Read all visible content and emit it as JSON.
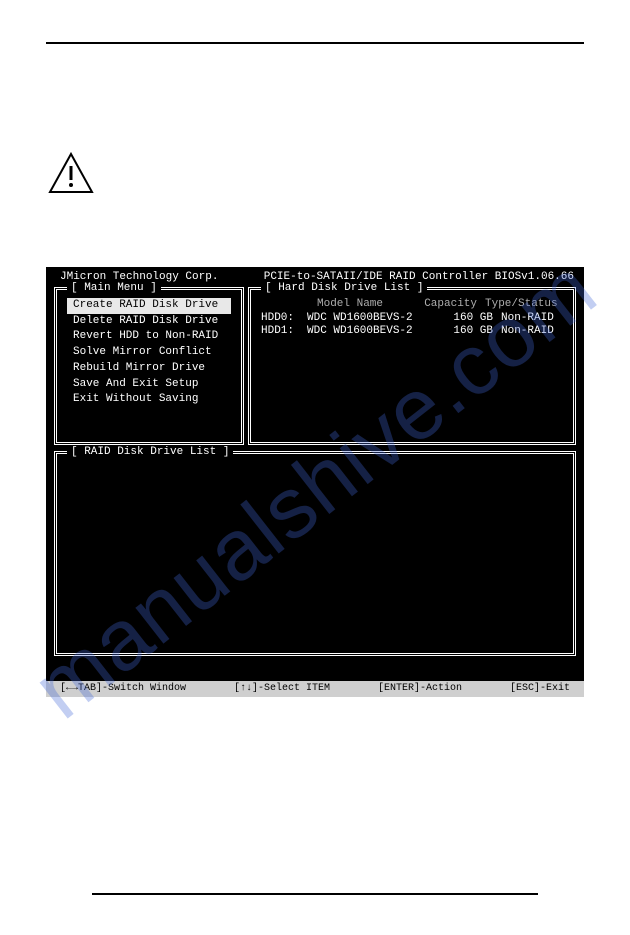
{
  "header": {
    "vendor": "JMicron Technology Corp.",
    "controller": "PCIE-to-SATAII/IDE RAID Controller BIOSv1.06.66"
  },
  "main_menu": {
    "title": "[ Main Menu ]",
    "items": [
      {
        "label": "Create RAID Disk Drive",
        "selected": true
      },
      {
        "label": "Delete RAID Disk Drive",
        "selected": false
      },
      {
        "label": "Revert HDD to Non-RAID",
        "selected": false
      },
      {
        "label": "Solve Mirror Conflict",
        "selected": false
      },
      {
        "label": "Rebuild Mirror Drive",
        "selected": false
      },
      {
        "label": "Save And Exit Setup",
        "selected": false
      },
      {
        "label": "Exit Without Saving",
        "selected": false
      }
    ]
  },
  "hdd_list": {
    "title": "[ Hard Disk Drive List ]",
    "columns": {
      "model": "Model Name",
      "capacity": "Capacity",
      "type": "Type/Status"
    },
    "rows": [
      {
        "id": "HDD0:",
        "model": "WDC WD1600BEVS-2",
        "capacity": "160 GB",
        "type": "Non-RAID"
      },
      {
        "id": "HDD1:",
        "model": "WDC WD1600BEVS-2",
        "capacity": "160 GB",
        "type": "Non-RAID"
      }
    ]
  },
  "raid_list": {
    "title": "[ RAID Disk Drive List ]"
  },
  "statusbar": {
    "switch": "[←→TAB]-Switch Window",
    "select": "[↑↓]-Select ITEM",
    "action": "[ENTER]-Action",
    "exit": "[ESC]-Exit"
  },
  "watermark": "manualshive.com"
}
